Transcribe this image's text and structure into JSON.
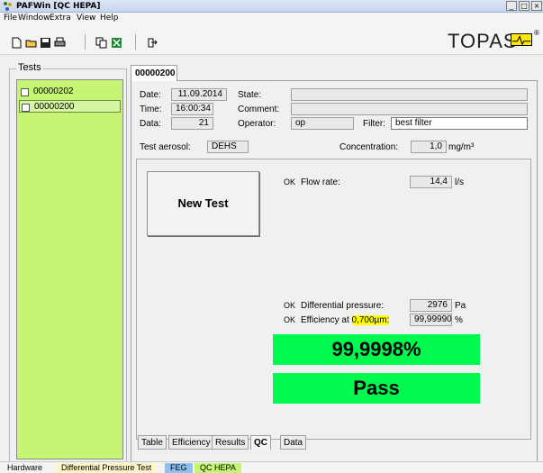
{
  "window": {
    "title": "PAFWin   [QC HEPA]",
    "controls": [
      "_",
      "□",
      "×"
    ]
  },
  "menu": [
    "File",
    "Window",
    "Extra",
    "View",
    "Help"
  ],
  "toolbar": {
    "icons": [
      "new-file-icon",
      "open-folder-icon",
      "save-icon",
      "print-icon",
      "copy-icon",
      "excel-icon",
      "exit-icon"
    ],
    "logo_text": "TOPAS",
    "logo_sup": "®"
  },
  "tests_panel": {
    "title": "Tests",
    "items": [
      "00000202",
      "00000200"
    ]
  },
  "document": {
    "tab": "00000200",
    "date_label": "Date:",
    "date": "11.09.2014",
    "time_label": "Time:",
    "time": "16:00:34",
    "data_label": "Data:",
    "data": "21",
    "state_label": "State:",
    "state": "",
    "comment_label": "Comment:",
    "comment": "",
    "operator_label": "Operator:",
    "operator": "op",
    "filter_label": "Filter:",
    "filter": "best filter",
    "aerosol_label": "Test aerosol:",
    "aerosol": "DEHS",
    "concentration_label": "Concentration:",
    "concentration": "1,0",
    "concentration_unit": "mg/m³"
  },
  "qc": {
    "new_test": "New Test",
    "flow_ok": "OK",
    "flow_label": "Flow rate:",
    "flow_value": "14,4",
    "flow_unit": "l/s",
    "dp_ok": "OK",
    "dp_label": "Differential pressure:",
    "dp_value": "2976",
    "dp_unit": "Pa",
    "eff_ok": "OK",
    "eff_label_pre": "Efficiency at ",
    "eff_label_hl": "0,700µm:",
    "eff_value": "99,99990",
    "eff_unit": "%",
    "result_value": "99,9998%",
    "result_status": "Pass",
    "status_color": "#00f94e"
  },
  "subtabs": [
    "Table",
    "Efficiency",
    "Results",
    "QC",
    "Data"
  ],
  "statusbar": [
    {
      "label": "Hardware",
      "color": "#f4f4f4"
    },
    {
      "label": "Differential Pressure Test",
      "color": "#fff6c8"
    },
    {
      "label": "FEG",
      "color": "#8fc1f0"
    },
    {
      "label": "QC HEPA",
      "color": "#c6f575"
    }
  ]
}
